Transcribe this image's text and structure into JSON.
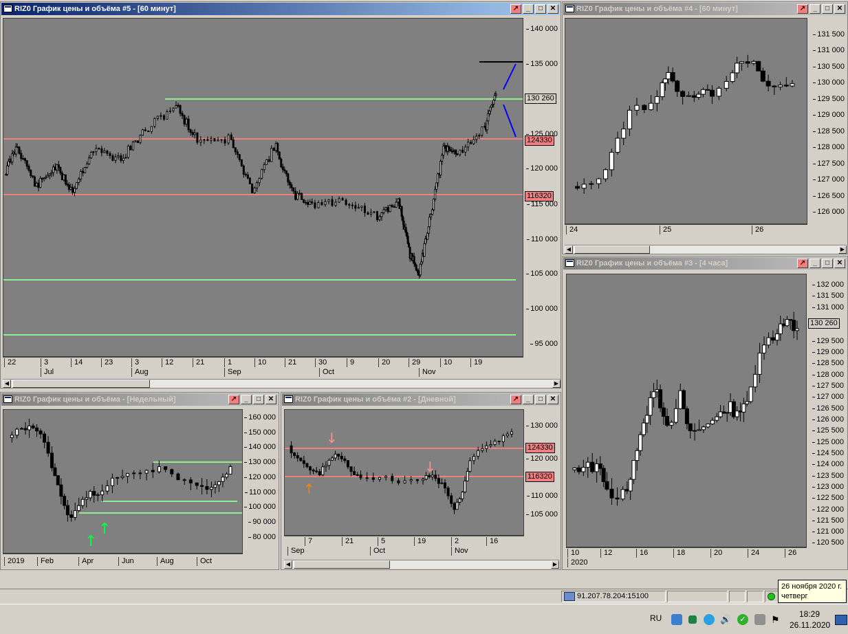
{
  "windows": {
    "w5": {
      "title": "RIZ0 График цены и объёма #5 - [60 минут]",
      "y_labels": [
        "140 000",
        "135 000",
        "130 260",
        "125 000",
        "120 000",
        "115 000",
        "110 000",
        "105 000",
        "100 000",
        "95 000"
      ],
      "price_tags": [
        "130 260",
        "124330",
        "116320"
      ],
      "x_days": [
        "22",
        "3",
        "14",
        "23",
        "3",
        "12",
        "21",
        "1",
        "10",
        "21",
        "30",
        "9",
        "20",
        "29",
        "10",
        "19"
      ],
      "x_months": [
        "Jul",
        "Aug",
        "Sep",
        "Oct",
        "Nov"
      ]
    },
    "w4": {
      "title": "RIZ0 График цены и объёма #4 - [60 минут]",
      "y_labels": [
        "131 500",
        "131 000",
        "130 500",
        "130 000",
        "129 500",
        "129 000",
        "128 500",
        "128 000",
        "127 500",
        "127 000",
        "126 500",
        "126 000"
      ],
      "x_days": [
        "24",
        "25",
        "26"
      ]
    },
    "w3": {
      "title": "RIZ0 График цены и объёма #3 - [4 часа]",
      "y_labels": [
        "132 000",
        "131 500",
        "131 000",
        "130 260",
        "129 500",
        "129 000",
        "128 500",
        "128 000",
        "127 500",
        "127 000",
        "126 500",
        "126 000",
        "125 500",
        "125 000",
        "124 500",
        "124 000",
        "123 500",
        "123 000",
        "122 500",
        "122 000",
        "121 500",
        "121 000",
        "120 500"
      ],
      "price_tags": [
        "130 260"
      ],
      "x_days": [
        "10",
        "12",
        "16",
        "18",
        "20",
        "24",
        "26"
      ],
      "x_year": "2020"
    },
    "wweek": {
      "title": "RIZ0 График цены и объёма - [Недельный]",
      "y_labels": [
        "160 000",
        "150 000",
        "140 000",
        "130 000",
        "120 000",
        "110 000",
        "100 000",
        "90 000",
        "80 000"
      ],
      "x_labels": [
        "2019",
        "Feb",
        "Apr",
        "Jun",
        "Aug",
        "Oct"
      ]
    },
    "w2": {
      "title": "RIZ0 График цены и объёма #2 - [Дневной]",
      "y_labels": [
        "130 000",
        "124330",
        "120 000",
        "116320",
        "110 000",
        "105 000"
      ],
      "price_tags": [
        "124330",
        "116320"
      ],
      "x_days": [
        "7",
        "21",
        "5",
        "19",
        "2",
        "16"
      ],
      "x_months": [
        "Sep",
        "Oct",
        "Nov"
      ]
    }
  },
  "status": {
    "connection": "91.207.78.204:15100"
  },
  "taskbar": {
    "lang": "RU",
    "time": "18:29",
    "date": "26.11.2020"
  },
  "tooltip": {
    "line1": "26 ноября 2020 г.",
    "line2": "четверг"
  },
  "colors": {
    "plot_bg": "#808080",
    "support_red": "#f08080",
    "support_green": "#90ee90",
    "title_active": "#0a246a",
    "title_inactive": "#808080"
  }
}
